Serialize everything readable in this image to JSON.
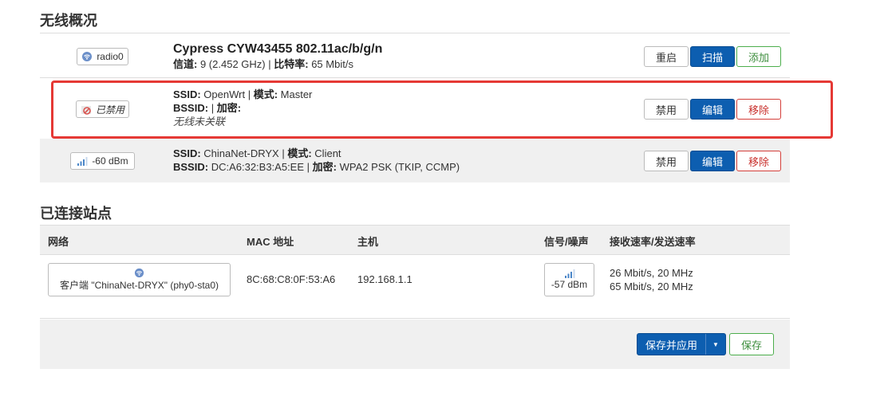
{
  "wireless_overview": {
    "title": "无线概况",
    "radio": {
      "badge": "radio0",
      "name": "Cypress CYW43455 802.11ac/b/g/n",
      "channel_label": "信道:",
      "channel_value": "9 (2.452 GHz)",
      "bitrate_label": "比特率:",
      "bitrate_value": "65 Mbit/s",
      "buttons": {
        "restart": "重启",
        "scan": "扫描",
        "add": "添加"
      }
    },
    "networks": [
      {
        "badge": "已禁用",
        "ssid_label": "SSID:",
        "ssid": "OpenWrt",
        "mode_label": "模式:",
        "mode": "Master",
        "bssid_label": "BSSID:",
        "bssid": "",
        "enc_label": "加密:",
        "enc": "",
        "note": "无线未关联",
        "buttons": {
          "disable": "禁用",
          "edit": "编辑",
          "remove": "移除"
        }
      },
      {
        "badge": "-60 dBm",
        "ssid_label": "SSID:",
        "ssid": "ChinaNet-DRYX",
        "mode_label": "模式:",
        "mode": "Client",
        "bssid_label": "BSSID:",
        "bssid": "DC:A6:32:B3:A5:EE",
        "enc_label": "加密:",
        "enc": "WPA2 PSK (TKIP, CCMP)",
        "buttons": {
          "disable": "禁用",
          "edit": "编辑",
          "remove": "移除"
        }
      }
    ]
  },
  "connected_stations": {
    "title": "已连接站点",
    "headers": [
      "网络",
      "MAC 地址",
      "主机",
      "信号/噪声",
      "接收速率/发送速率"
    ],
    "rows": [
      {
        "network": "客户端 \"ChinaNet-DRYX\" (phy0-sta0)",
        "mac": "8C:68:C8:0F:53:A6",
        "host": "192.168.1.1",
        "signal": "-57 dBm",
        "rx_rate": "26 Mbit/s, 20 MHz",
        "tx_rate": "65 Mbit/s, 20 MHz"
      }
    ]
  },
  "footer": {
    "save_apply": "保存并应用",
    "save": "保存"
  },
  "colors": {
    "primary": "#0d5eb0",
    "success": "#4cae4c",
    "danger": "#d43f3a",
    "highlight": "#e53935"
  }
}
